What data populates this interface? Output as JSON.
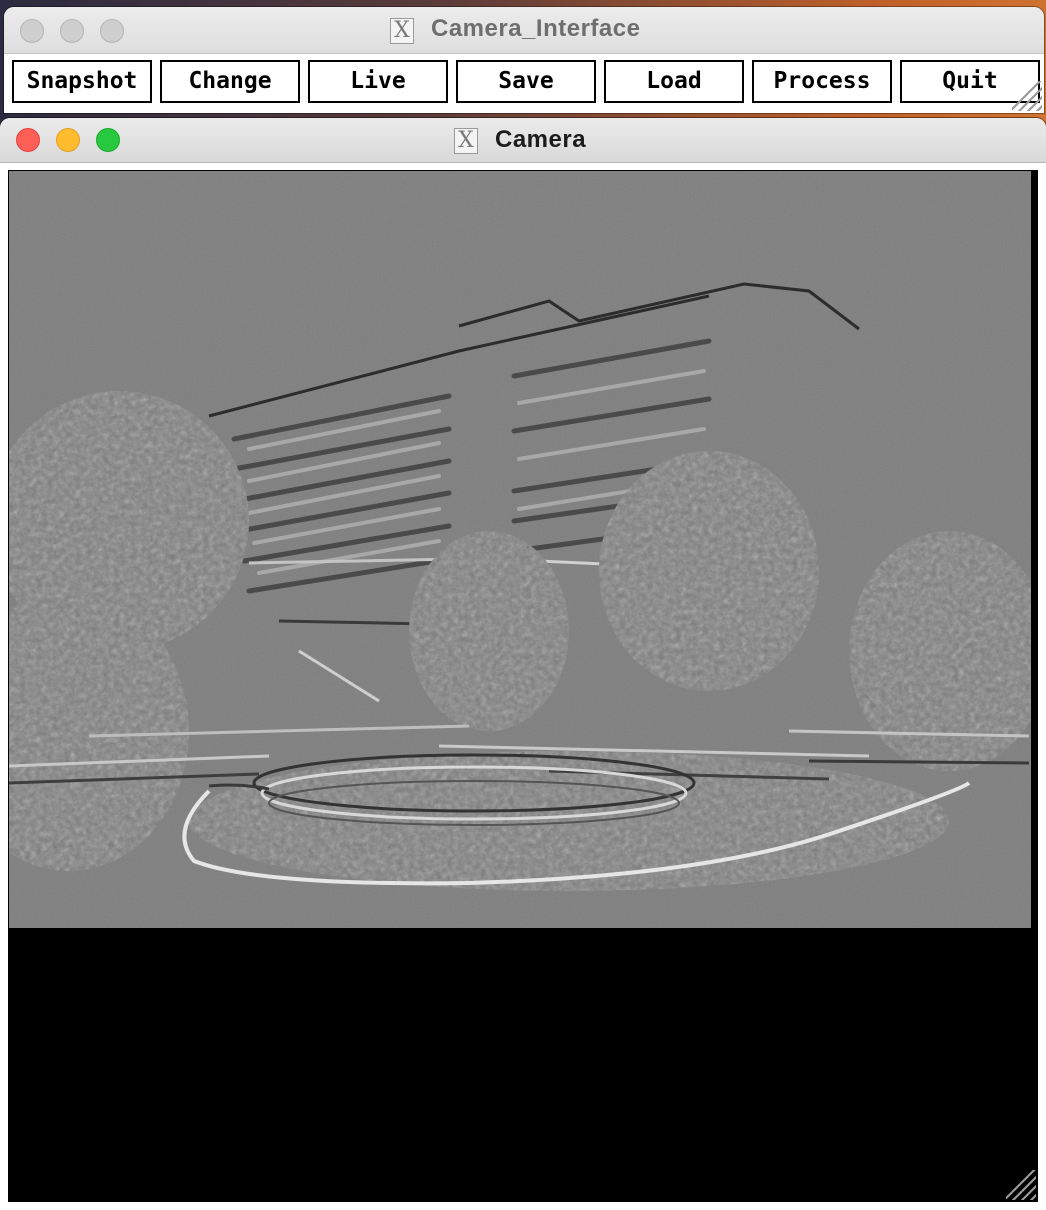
{
  "interface_window": {
    "title": "Camera_Interface",
    "buttons": [
      "Snapshot",
      "Change",
      "Live",
      "Save",
      "Load",
      "Process",
      "Quit"
    ]
  },
  "camera_window": {
    "title": "Camera"
  },
  "icons": {
    "x11": "X"
  },
  "colors": {
    "traffic_red": "#fe5f57",
    "traffic_yellow": "#febc2e",
    "traffic_green": "#28c840",
    "image_gray": "#7d7d7d",
    "canvas_black": "#000000"
  }
}
